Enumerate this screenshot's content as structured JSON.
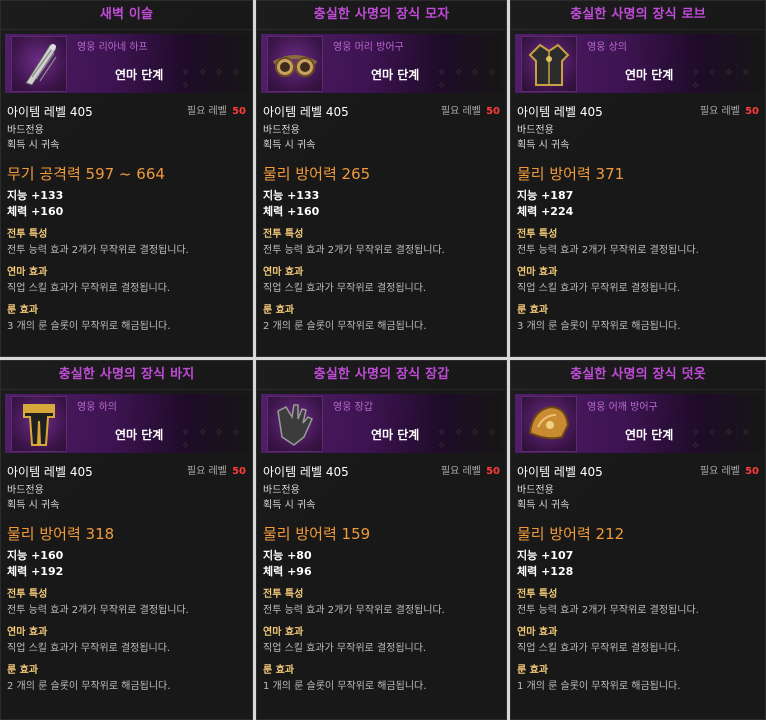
{
  "labels": {
    "stage": "연마 단계",
    "item_level": "아이템 레벨 405",
    "req_level_label": "필요 레벨",
    "req_level_value": "50",
    "class_req": "바드전용",
    "bind": "획득 시 귀속",
    "combat_title": "전투 특성",
    "combat_text": "전투 능력 효과 2개가 무작위로 결정됩니다.",
    "refine_title": "연마 효과",
    "refine_text": "직업 스킬 효과가 무작위로 결정됩니다.",
    "rune_title": "룬 효과",
    "stars": "✧ ✧ ✧ ✧ ✧"
  },
  "cards": [
    {
      "name": "새벽 이슬",
      "grade": "영웅 리아네 하프",
      "main_stat": "무기 공격력 597 ~ 664",
      "stat1": "지능 +133",
      "stat2": "체력 +160",
      "rune_text": "3 개의 룬 슬롯이 무작위로 해금됩니다.",
      "icon": "harp-icon"
    },
    {
      "name": "충실한 사명의 장식 모자",
      "grade": "영웅 머리 방어구",
      "main_stat": "물리 방어력 265",
      "stat1": "지능 +133",
      "stat2": "체력 +160",
      "rune_text": "2 개의 룬 슬롯이 무작위로 해금됩니다.",
      "icon": "goggles-icon"
    },
    {
      "name": "충실한 사명의 장식 로브",
      "grade": "영웅 상의",
      "main_stat": "물리 방어력 371",
      "stat1": "지능 +187",
      "stat2": "체력 +224",
      "rune_text": "3 개의 룬 슬롯이 무작위로 해금됩니다.",
      "icon": "robe-icon"
    },
    {
      "name": "충실한 사명의 장식 바지",
      "grade": "영웅 하의",
      "main_stat": "물리 방어력 318",
      "stat1": "지능 +160",
      "stat2": "체력 +192",
      "rune_text": "2 개의 룬 슬롯이 무작위로 해금됩니다.",
      "icon": "pants-icon"
    },
    {
      "name": "충실한 사명의 장식 장갑",
      "grade": "영웅 장갑",
      "main_stat": "물리 방어력 159",
      "stat1": "지능 +80",
      "stat2": "체력 +96",
      "rune_text": "1 개의 룬 슬롯이 무작위로 해금됩니다.",
      "icon": "glove-icon"
    },
    {
      "name": "충실한 사명의 장식 덧옷",
      "grade": "영웅 어깨 방어구",
      "main_stat": "물리 방어력 212",
      "stat1": "지능 +107",
      "stat2": "체력 +128",
      "rune_text": "1 개의 룬 슬롯이 무작위로 해금됩니다.",
      "icon": "shoulder-icon"
    }
  ]
}
